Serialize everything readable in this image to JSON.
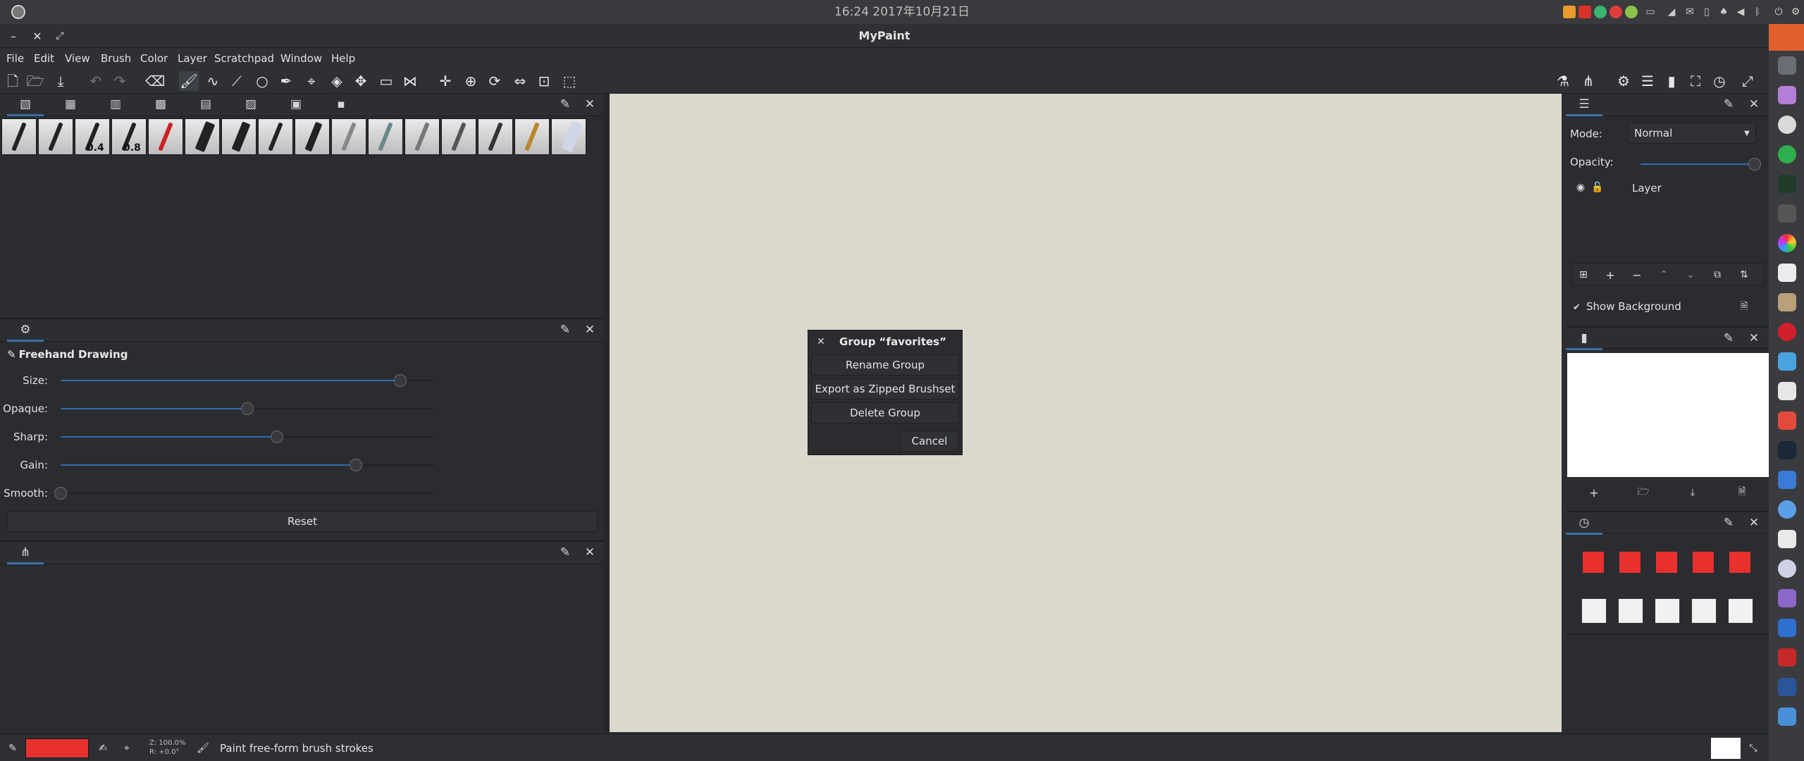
{
  "system": {
    "clock": "16:24 2017年10月21日"
  },
  "window": {
    "title": "MyPaint"
  },
  "menu": [
    "File",
    "Edit",
    "View",
    "Brush",
    "Color",
    "Layer",
    "Scratchpad",
    "Window",
    "Help"
  ],
  "brushes": {
    "labels": [
      "",
      "",
      "0.4",
      "0.8",
      "",
      "",
      "",
      "",
      "",
      "",
      "",
      "",
      "",
      "",
      "",
      ""
    ]
  },
  "brush_settings": {
    "title": "Freehand Drawing",
    "sliders": [
      {
        "label": "Size:",
        "value": 0.91
      },
      {
        "label": "Opaque:",
        "value": 0.5
      },
      {
        "label": "Sharp:",
        "value": 0.58
      },
      {
        "label": "Gain:",
        "value": 0.79
      },
      {
        "label": "Smooth:",
        "value": 0.0
      }
    ],
    "reset_label": "Reset"
  },
  "dialog": {
    "title": "Group “favorites”",
    "rename": "Rename Group",
    "export": "Export as Zipped Brushset",
    "delete": "Delete Group",
    "cancel": "Cancel"
  },
  "layers": {
    "mode_label": "Mode:",
    "mode_value": "Normal",
    "opacity_label": "Opacity:",
    "opacity_value": 1.0,
    "layer_name": "Layer",
    "show_background": "Show Background"
  },
  "colors": {
    "accent": "#2f6bb8",
    "current_color": "#e8302f",
    "canvas": "#dbd9cd"
  },
  "status": {
    "zoom": "Z: 100.0%",
    "rotation": "R: +0.0°",
    "message": "Paint free-form brush strokes"
  }
}
